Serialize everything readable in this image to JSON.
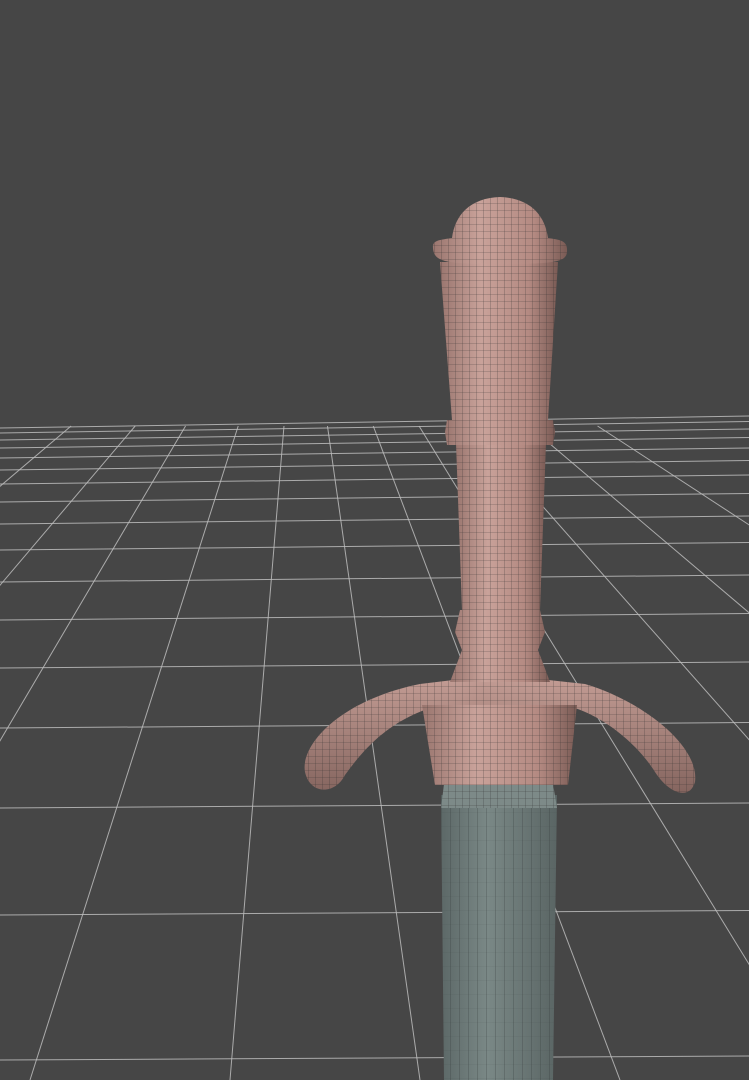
{
  "viewport": {
    "background_color": "#464646",
    "grid_color": "#bdbdbd",
    "mesh_wire_color": "#2b2b2b",
    "wireframe_overlay": true
  },
  "model": {
    "hilt_material_color": "#b68d84",
    "hilt_shadow_color": "#7e5f59",
    "blade_material_color": "#6d7b79",
    "blade_shadow_color": "#55605f",
    "parts": [
      "pommel",
      "grip",
      "collar",
      "crossguard",
      "ricasso",
      "blade"
    ]
  }
}
